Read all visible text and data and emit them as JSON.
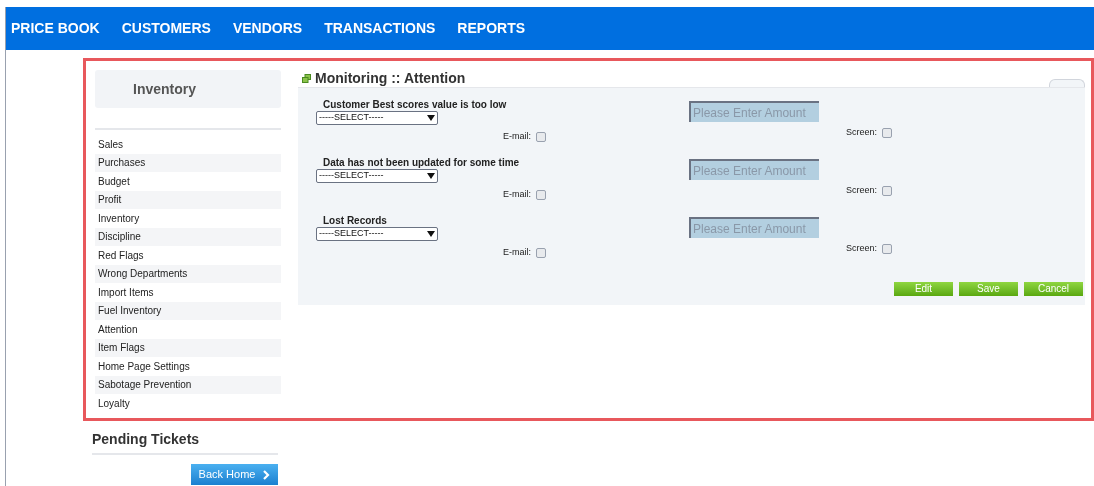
{
  "nav": [
    {
      "label": "PRICE BOOK"
    },
    {
      "label": "CUSTOMERS"
    },
    {
      "label": "VENDORS"
    },
    {
      "label": "TRANSACTIONS"
    },
    {
      "label": "REPORTS"
    }
  ],
  "sidebar": {
    "title": "Inventory",
    "items": [
      {
        "label": "Sales"
      },
      {
        "label": "Purchases"
      },
      {
        "label": "Budget"
      },
      {
        "label": "Profit"
      },
      {
        "label": "Inventory"
      },
      {
        "label": "Discipline"
      },
      {
        "label": "Red Flags"
      },
      {
        "label": "Wrong Departments"
      },
      {
        "label": "Import Items"
      },
      {
        "label": "Fuel Inventory"
      },
      {
        "label": "Attention"
      },
      {
        "label": "Item Flags"
      },
      {
        "label": "Home Page Settings"
      },
      {
        "label": "Sabotage Prevention"
      },
      {
        "label": "Loyalty"
      }
    ],
    "pending_title": "Pending Tickets",
    "back_button": "Back Home"
  },
  "panel": {
    "title": "Monitoring :: Attention",
    "alerts": [
      {
        "label": "Customer Best scores value is too low",
        "select": "-----SELECT-----",
        "amount_placeholder": "Please Enter Amount",
        "email_label": "E-mail:",
        "email_checked": false,
        "screen_label": "Screen:",
        "screen_checked": false
      },
      {
        "label": "Data has not been updated for some time",
        "select": "-----SELECT-----",
        "amount_placeholder": "Please Enter Amount",
        "email_label": "E-mail:",
        "email_checked": false,
        "screen_label": "Screen:",
        "screen_checked": false
      },
      {
        "label": "Lost Records",
        "select": "-----SELECT-----",
        "amount_placeholder": "Please Enter Amount",
        "email_label": "E-mail:",
        "email_checked": false,
        "screen_label": "Screen:",
        "screen_checked": false
      }
    ],
    "buttons": [
      "Edit",
      "Save",
      "Cancel"
    ]
  }
}
